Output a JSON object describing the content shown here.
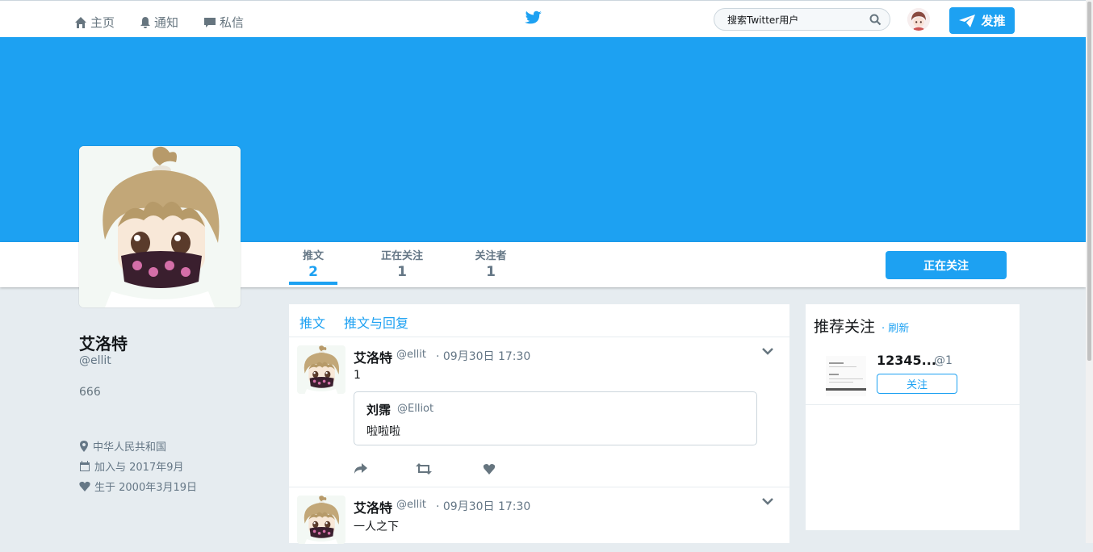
{
  "nav": {
    "home": "主页",
    "notifications": "通知",
    "messages": "私信",
    "search_placeholder": "搜索Twitter用户",
    "tweet_button": "发推"
  },
  "profile": {
    "name": "艾洛特",
    "handle": "@ellit",
    "bio": "666",
    "location": "中华人民共和国",
    "joined": "加入与 2017年9月",
    "birthday": "生于 2000年3月19日",
    "follow_button": "正在关注"
  },
  "stats": [
    {
      "label": "推文",
      "value": "2"
    },
    {
      "label": "正在关注",
      "value": "1"
    },
    {
      "label": "关注者",
      "value": "1"
    }
  ],
  "timeline": {
    "tabs": [
      "推文",
      "推文与回复"
    ],
    "tweets": [
      {
        "name": "艾洛特",
        "handle": "@ellit",
        "time": "· 09月30日 17:30",
        "text": "1",
        "quote": {
          "name": "刘霈",
          "handle": "@Elliot",
          "text": "啦啦啦"
        }
      },
      {
        "name": "艾洛特",
        "handle": "@ellit",
        "time": "· 09月30日 17:30",
        "text": "一人之下"
      }
    ]
  },
  "who_to_follow": {
    "title": "推荐关注",
    "refresh": "· 刷新",
    "items": [
      {
        "name": "12345...",
        "handle": "@1",
        "follow": "关注"
      }
    ]
  },
  "colors": {
    "accent": "#1da1f2",
    "background": "#e6ecf0"
  },
  "icons": [
    "home-icon",
    "bell-icon",
    "message-icon",
    "twitter-bird-icon",
    "search-icon",
    "send-icon",
    "location-icon",
    "calendar-icon",
    "heart-icon",
    "reply-icon",
    "retweet-icon",
    "like-icon",
    "chevron-down-icon"
  ]
}
